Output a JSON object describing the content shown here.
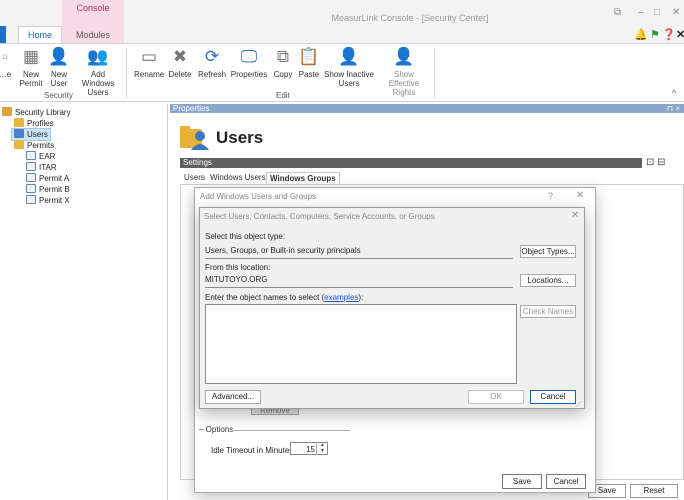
{
  "window": {
    "title": "MeasurLink Console - [Security Center]",
    "contextual_tab_group": "Console",
    "tabs": [
      "Home",
      "Modules"
    ],
    "controls": {
      "restore": "⧉",
      "minimize": "–",
      "maximize": "□",
      "close": "✕"
    },
    "toolbar_icons": [
      "bell-icon",
      "flag-icon",
      "help-icon",
      "close-icon"
    ]
  },
  "ribbon": {
    "security_group": {
      "label": "Security",
      "buttons": [
        {
          "label": "…e",
          "icon": "delete-icon"
        },
        {
          "label": "New Permit",
          "icon": "new-permit-icon"
        },
        {
          "label": "New User",
          "icon": "new-user-icon"
        },
        {
          "label": "Add Windows Users",
          "icon": "add-windows-users-icon"
        }
      ]
    },
    "edit_group": {
      "label": "Edit",
      "buttons": [
        {
          "label": "Rename",
          "icon": "rename-icon"
        },
        {
          "label": "Delete",
          "icon": "delete-icon"
        },
        {
          "label": "Refresh",
          "icon": "refresh-icon"
        },
        {
          "label": "Properties",
          "icon": "properties-icon"
        },
        {
          "label": "Copy",
          "icon": "copy-icon"
        },
        {
          "label": "Paste",
          "icon": "paste-icon"
        },
        {
          "label": "Show Inactive Users",
          "icon": "show-inactive-users-icon"
        },
        {
          "label": "Show Effective Rights",
          "icon": "show-effective-rights-icon"
        }
      ]
    },
    "collapse_glyph": "^"
  },
  "tree": {
    "root": "Security Library",
    "profiles": "Profiles",
    "users": "Users",
    "permits": "Permits",
    "permit_items": [
      "EAR",
      "ITAR",
      "Permit A",
      "Permit B",
      "Permit X"
    ]
  },
  "properties": {
    "header": "Properties",
    "pin": "⊓ ×",
    "title": "Users",
    "settings_label": "Settings",
    "tabs": [
      "Users",
      "Windows Users",
      "Windows Groups"
    ],
    "save_label": "Save",
    "reset_label": "Reset"
  },
  "dialog_add": {
    "title": "Add Windows Users and Groups",
    "help": "?",
    "close": "✕",
    "remove_label": "Remove",
    "options_legend": "Options",
    "idle_label": "Idle Timeout in Minutes:",
    "idle_value": "15",
    "save_label": "Save",
    "cancel_label": "Cancel"
  },
  "dialog_select": {
    "title": "Select Users, Contacts, Computers, Service Accounts, or Groups",
    "close": "✕",
    "object_type_label": "Select this object type:",
    "object_type_value": "Users, Groups, or Built-in security principals",
    "object_types_button": "Object Types...",
    "location_label": "From this location:",
    "location_value": "MITUTOYO.ORG",
    "locations_button": "Locations...",
    "enter_names_label": "Enter the object names to select (",
    "enter_names_link": "examples",
    "enter_names_suffix": "):",
    "names_value": "",
    "check_names_button": "Check Names",
    "advanced_button": "Advanced...",
    "ok_button": "OK",
    "cancel_button": "Cancel"
  },
  "colors": {
    "accent": "#1f5fa8",
    "contextual_tab": "#f6dbe6",
    "properties_header": "#8aa7c9",
    "settings_bar": "#606060"
  }
}
